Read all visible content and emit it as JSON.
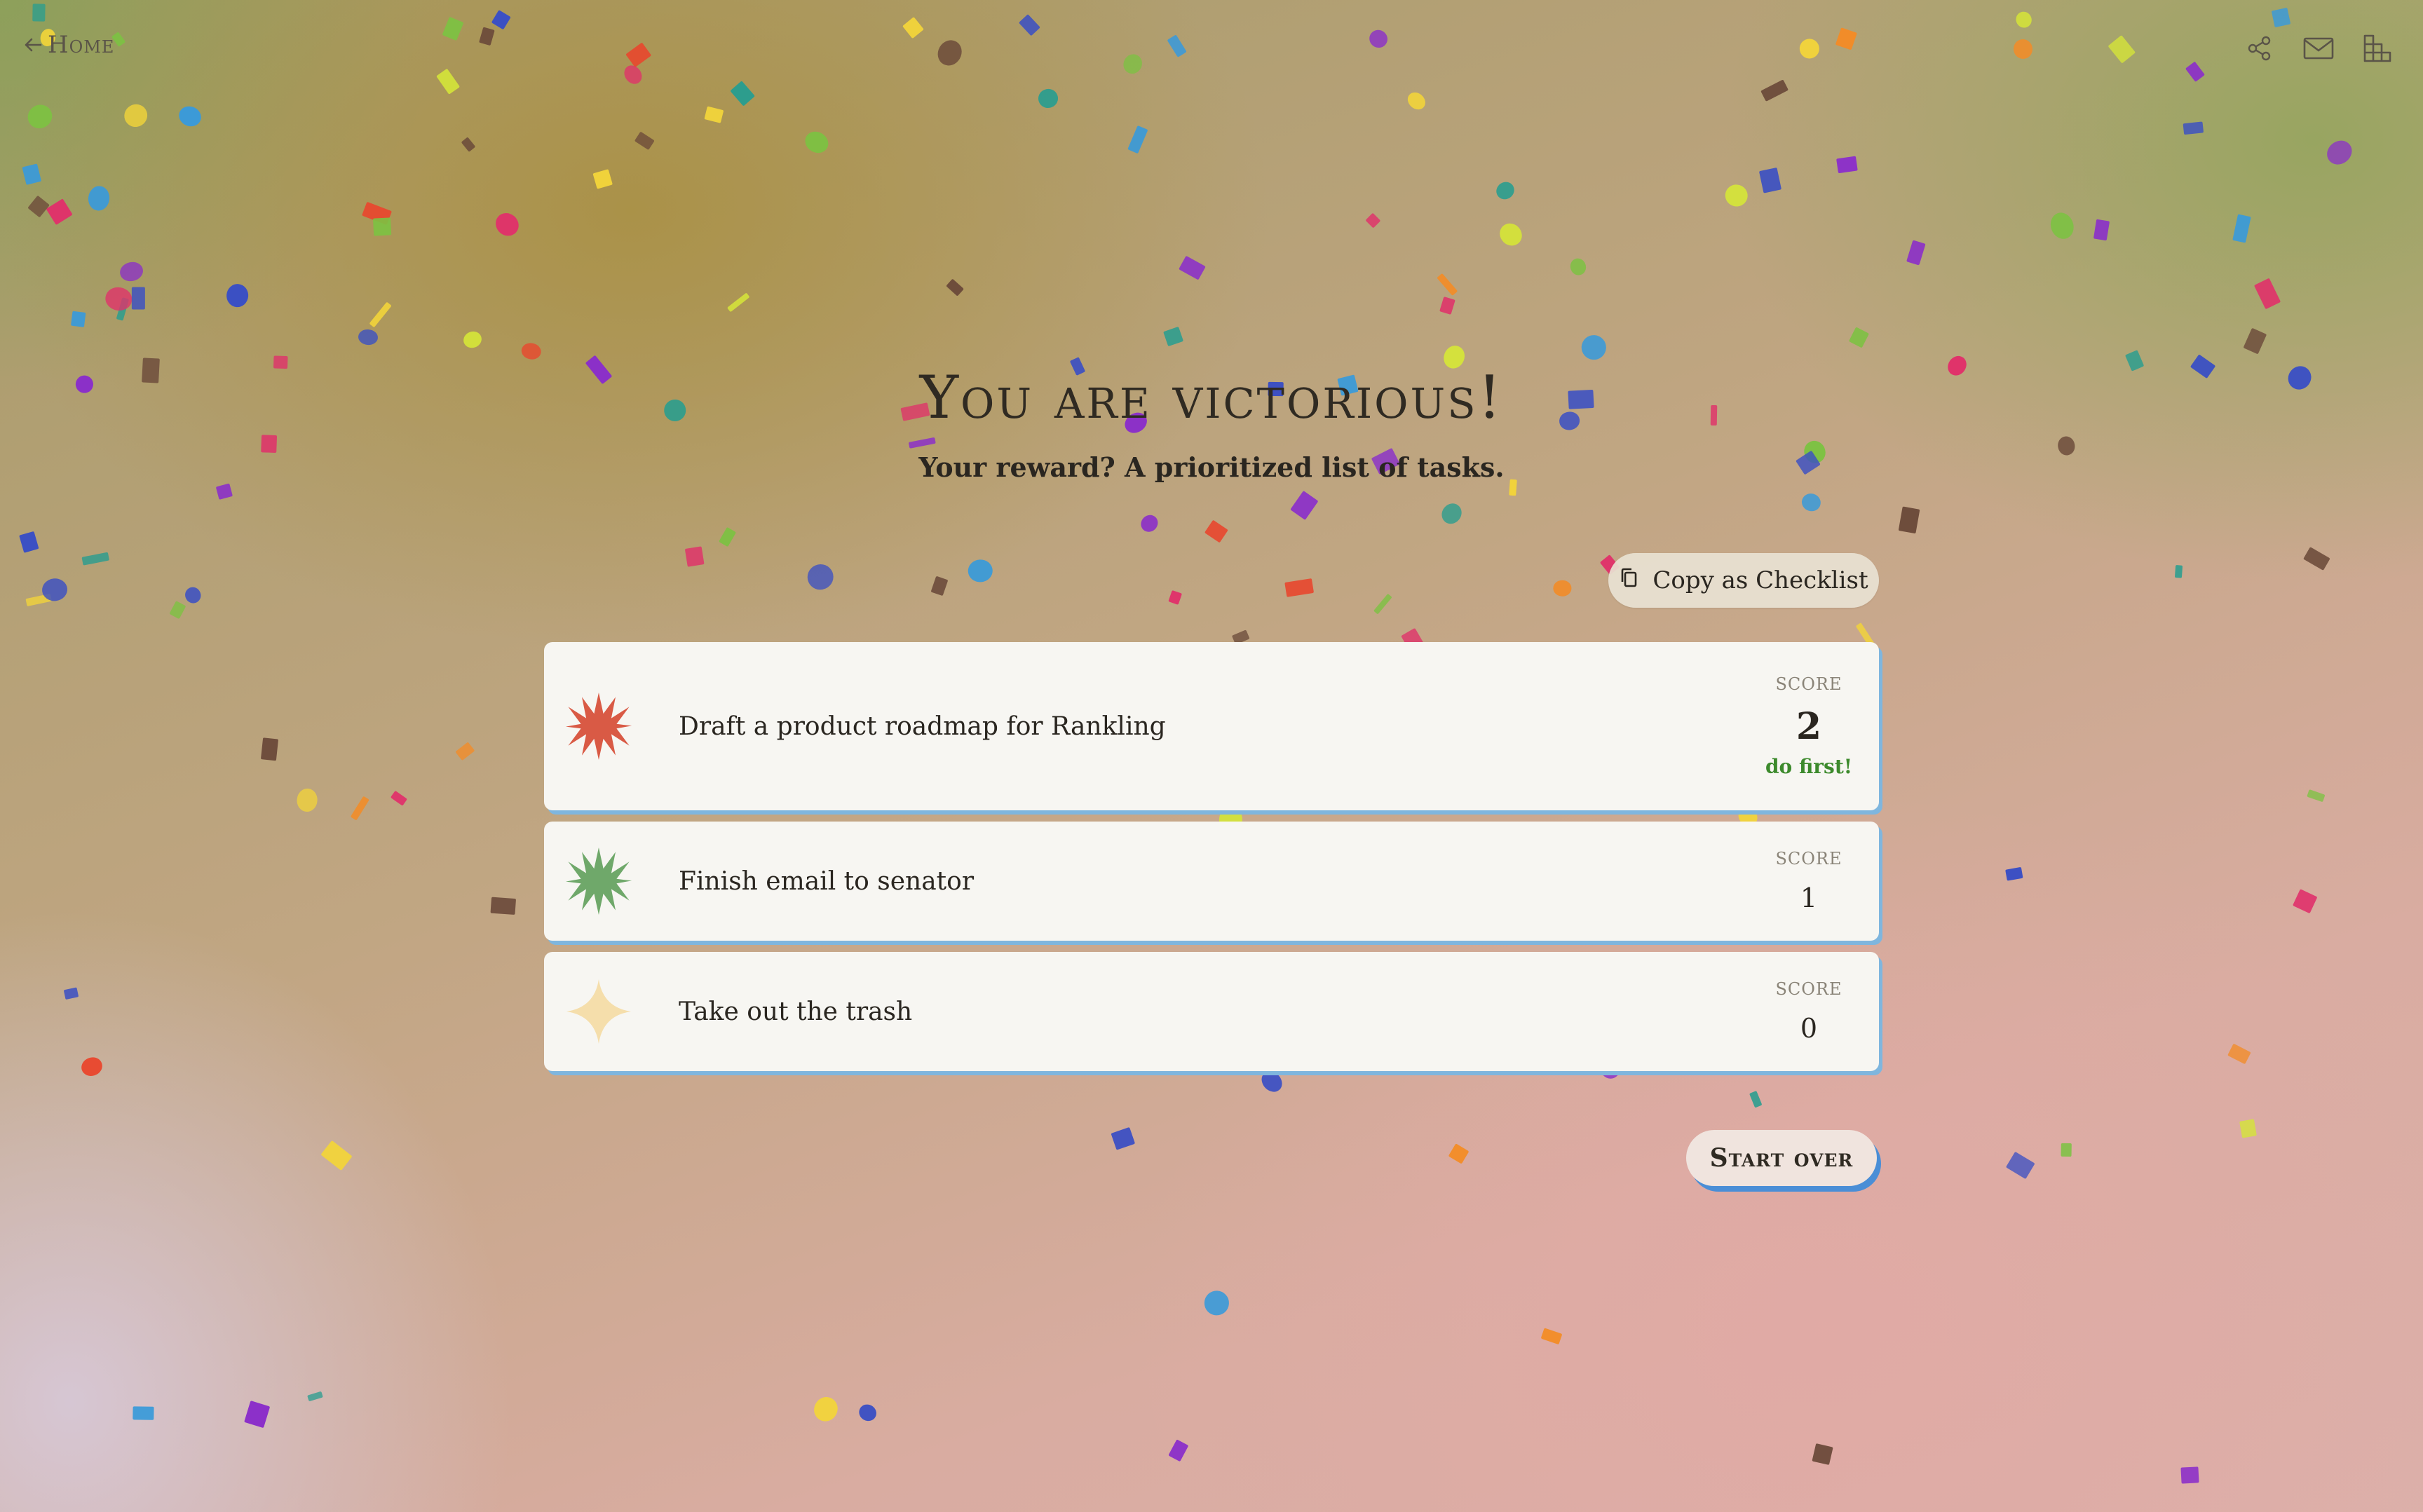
{
  "nav": {
    "home_label": "Home",
    "home_icon": "arrow-left-icon",
    "icons": [
      "share-icon",
      "mail-icon",
      "grid-chart-icon"
    ]
  },
  "heading": {
    "title": "You are victorious!",
    "subtitle": "Your reward? A prioritized list of tasks."
  },
  "copy_button": {
    "label": "Copy as Checklist",
    "icon": "copy-icon"
  },
  "tasks": [
    {
      "text": "Draft a product roadmap for Rankling",
      "score_label": "SCORE",
      "score": "2",
      "note": "do first!",
      "star_color": "#d95a45",
      "star_icon": "starburst-icon"
    },
    {
      "text": "Finish email to senator",
      "score_label": "SCORE",
      "score": "1",
      "note": "",
      "star_color": "#6fa86a",
      "star_icon": "starburst-icon"
    },
    {
      "text": "Take out the trash",
      "score_label": "SCORE",
      "score": "0",
      "note": "",
      "star_color": "#f5deab",
      "star_icon": "four-point-star-icon"
    }
  ],
  "start_over_button": {
    "label": "Start over"
  },
  "colors": {
    "card_shadow": "#7fb6de",
    "start_shadow": "#4a8ed6",
    "note_green": "#3c8a2c"
  }
}
